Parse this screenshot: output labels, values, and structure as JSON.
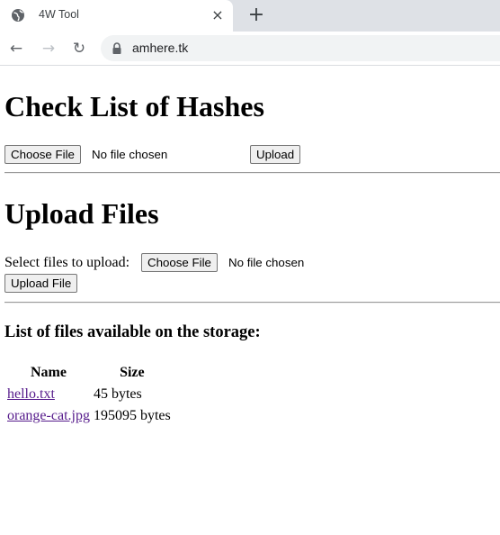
{
  "browser": {
    "tab_title": "4W Tool",
    "url": "amhere.tk",
    "close_glyph": "×",
    "new_tab_glyph": "+",
    "back_glyph": "←",
    "forward_glyph": "→",
    "reload_glyph": "↻"
  },
  "hash_section": {
    "heading": "Check List of Hashes",
    "choose_file_label": "Choose File",
    "no_file_text": "No file chosen",
    "upload_label": "Upload"
  },
  "upload_section": {
    "heading": "Upload Files",
    "select_label": "Select files to upload:",
    "choose_file_label": "Choose File",
    "no_file_text": "No file chosen",
    "upload_label": "Upload File"
  },
  "storage_section": {
    "heading": "List of files available on the storage:",
    "columns": [
      "Name",
      "Size"
    ],
    "files": [
      {
        "name": "hello.txt",
        "size": "45 bytes"
      },
      {
        "name": "orange-cat.jpg",
        "size": "195095 bytes"
      }
    ]
  },
  "colors": {
    "tabstrip_bg": "#dee1e6",
    "omnibox_bg": "#f1f3f4",
    "visited_link": "#551a8b"
  }
}
